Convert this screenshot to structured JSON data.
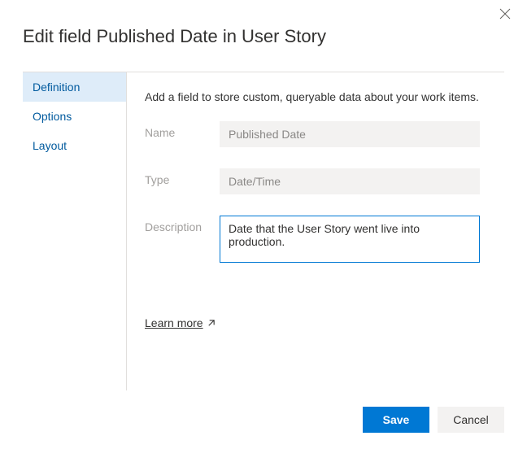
{
  "dialog": {
    "title": "Edit field Published Date in User Story"
  },
  "sidebar": {
    "items": [
      {
        "label": "Definition",
        "active": true
      },
      {
        "label": "Options",
        "active": false
      },
      {
        "label": "Layout",
        "active": false
      }
    ]
  },
  "main": {
    "helper": "Add a field to store custom, queryable data about your work items.",
    "fields": {
      "name_label": "Name",
      "name_value": "Published Date",
      "type_label": "Type",
      "type_value": "Date/Time",
      "description_label": "Description",
      "description_value": "Date that the User Story went live into production."
    },
    "learn_more": "Learn more"
  },
  "footer": {
    "save": "Save",
    "cancel": "Cancel"
  }
}
